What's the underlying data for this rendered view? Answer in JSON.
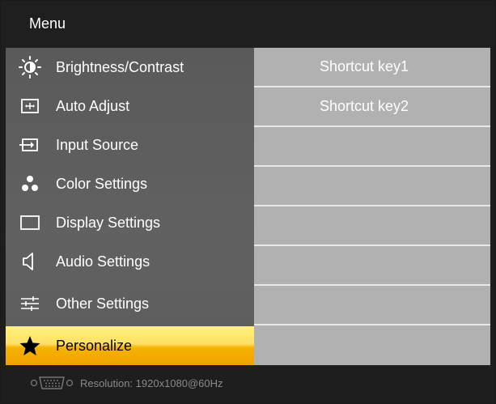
{
  "header": {
    "title": "Menu"
  },
  "menu": {
    "items": [
      {
        "label": "Brightness/Contrast",
        "icon": "brightness-icon"
      },
      {
        "label": "Auto Adjust",
        "icon": "auto-adjust-icon"
      },
      {
        "label": "Input Source",
        "icon": "input-source-icon"
      },
      {
        "label": "Color Settings",
        "icon": "color-settings-icon"
      },
      {
        "label": "Display Settings",
        "icon": "display-settings-icon"
      },
      {
        "label": "Audio Settings",
        "icon": "speaker-icon"
      },
      {
        "label": "Other Settings",
        "icon": "sliders-icon"
      },
      {
        "label": "Personalize",
        "icon": "star-icon",
        "selected": true
      }
    ]
  },
  "submenu": {
    "items": [
      {
        "label": "Shortcut key1"
      },
      {
        "label": "Shortcut key2"
      },
      {
        "label": ""
      },
      {
        "label": ""
      },
      {
        "label": ""
      },
      {
        "label": ""
      },
      {
        "label": ""
      },
      {
        "label": ""
      }
    ]
  },
  "footer": {
    "resolution": "Resolution:  1920x1080@60Hz",
    "icon": "vga-connector-icon"
  },
  "colors": {
    "selected_top": "#fff27a",
    "selected_bottom": "#f2a000",
    "submenu_bg": "#b1b1b1",
    "menu_bg": "#5e5e5e"
  }
}
